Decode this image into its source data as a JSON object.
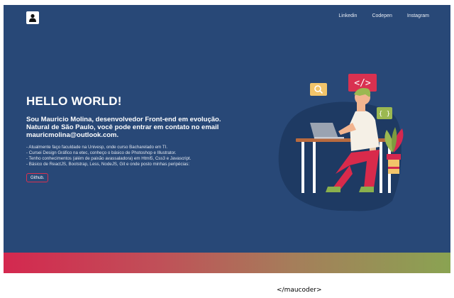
{
  "nav": {
    "items": [
      "Linkedin",
      "Codepen",
      "Instagram"
    ]
  },
  "hero": {
    "title": "HELLO WORLD!",
    "subtitle": "Sou Mauricio Molina, desenvolvedor Front-end em evolução. Natural de São Paulo, você pode entrar em contato no email mauricmolina@outlook.com.",
    "bullets": [
      "- Atualmente faço faculdade na Univesp, onde curso Bacharelado em TI.",
      "- Cursei Design Gráfico na etec, conheço o básico de Photoshop e Illustrator.",
      "- Tenho conhecimentos (além de paixão avassaladora) em Html5, Css3 e Javascript.",
      "- Básico de ReactJS, Bootstrap, Less, NodeJS, Git e onde posto minhas peripécias:"
    ],
    "button_label": "Github."
  },
  "illustration": {
    "code_tag": "</>",
    "braces": "{ }"
  },
  "footer": {
    "text": "</maucoder>"
  },
  "colors": {
    "background": "#284877",
    "accent": "#d93150",
    "gradient_start": "#d4284f",
    "gradient_end": "#8aa352"
  },
  "icons": {
    "logo": "user-icon",
    "search": "search-icon"
  }
}
